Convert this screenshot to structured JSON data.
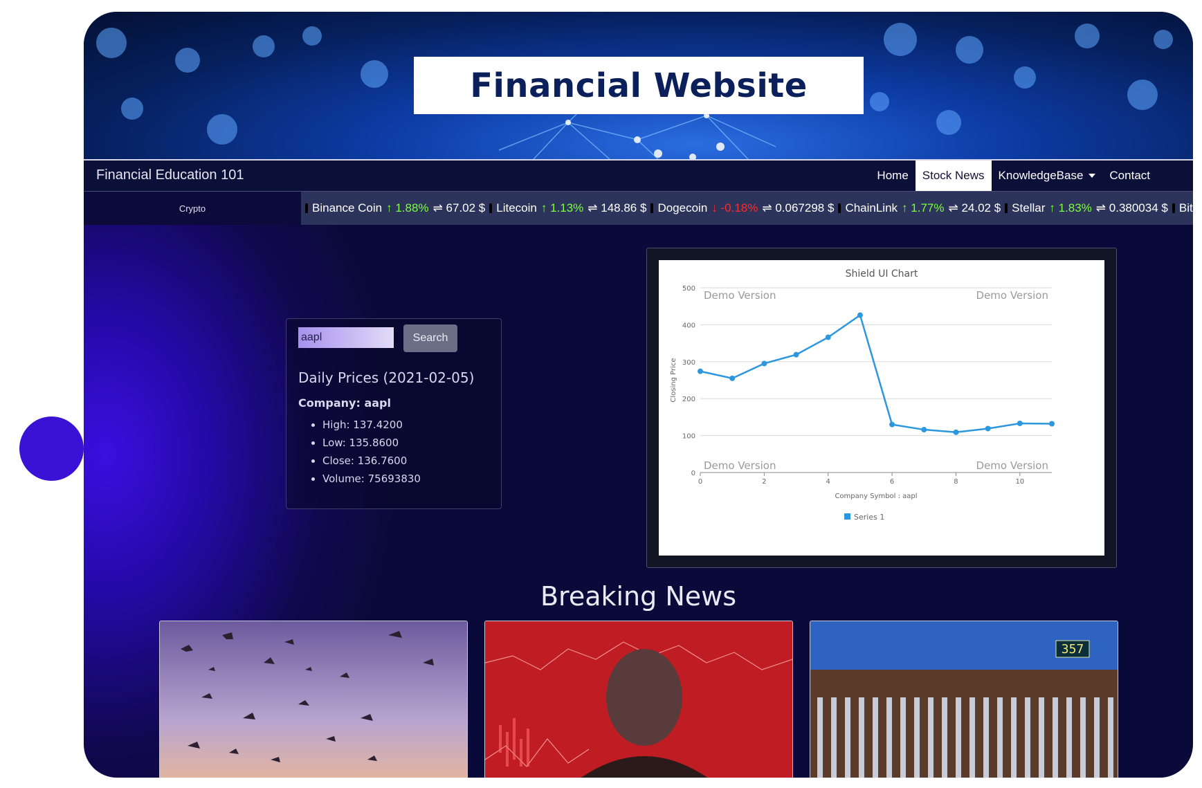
{
  "banner": {
    "title": "Financial Website"
  },
  "navbar": {
    "brand": "Financial Education 101",
    "items": [
      {
        "label": "Home",
        "active": false
      },
      {
        "label": "Stock News",
        "active": true
      },
      {
        "label": "KnowledgeBase",
        "active": false,
        "dropdown": true
      },
      {
        "label": "Contact",
        "active": false
      }
    ]
  },
  "ticker": {
    "label": "Crypto",
    "items": [
      {
        "name": "Binance Coin",
        "arrow": "↑",
        "change": "1.88%",
        "direction": "up",
        "price": "⇌ 67.02 $"
      },
      {
        "name": "Litecoin",
        "arrow": "↑",
        "change": "1.13%",
        "direction": "up",
        "price": "⇌ 148.86 $"
      },
      {
        "name": "Dogecoin",
        "arrow": "↓",
        "change": "-0.18%",
        "direction": "down",
        "price": "⇌ 0.067298 $"
      },
      {
        "name": "ChainLink",
        "arrow": "↑",
        "change": "1.77%",
        "direction": "up",
        "price": "⇌ 24.02 $"
      },
      {
        "name": "Stellar",
        "arrow": "↑",
        "change": "1.83%",
        "direction": "up",
        "price": "⇌ 0.380034 $"
      },
      {
        "name": "Bitc",
        "arrow": "",
        "change": "",
        "direction": "up",
        "price": ""
      }
    ],
    "colors": {
      "up": "#7dff3a",
      "down": "#ff2a2a"
    }
  },
  "search": {
    "input_value": "aapl",
    "button_label": "Search",
    "heading": "Daily Prices (2021-02-05)",
    "company": "Company: aapl",
    "stats": [
      "High: 137.4200",
      "Low: 135.8600",
      "Close: 136.7600",
      "Volume: 75693830"
    ]
  },
  "chart_data": {
    "type": "line",
    "title": "Shield UI Chart",
    "xlabel": "Company Symbol : aapl",
    "ylabel": "Closing Price",
    "x": [
      0,
      1,
      2,
      3,
      4,
      5,
      6,
      7,
      8,
      9,
      10,
      11
    ],
    "series": [
      {
        "name": "Series 1",
        "color": "#2c97de",
        "values": [
          274,
          255,
          295,
          319,
          366,
          426,
          130,
          116,
          109,
          119,
          133,
          132
        ]
      }
    ],
    "xlim": [
      0,
      11
    ],
    "ylim": [
      0,
      500
    ],
    "xticks": [
      0,
      2,
      4,
      6,
      8,
      10
    ],
    "yticks": [
      0,
      100,
      200,
      300,
      400,
      500
    ],
    "grid": true,
    "legend": "bottom",
    "watermark": "Demo Version"
  },
  "news": {
    "title": "Breaking News",
    "cards": [
      {
        "image": "birds-flock-sunset"
      },
      {
        "image": "man-red-stock-charts"
      },
      {
        "image": "border-fence-357",
        "sign_text": "357"
      }
    ]
  }
}
